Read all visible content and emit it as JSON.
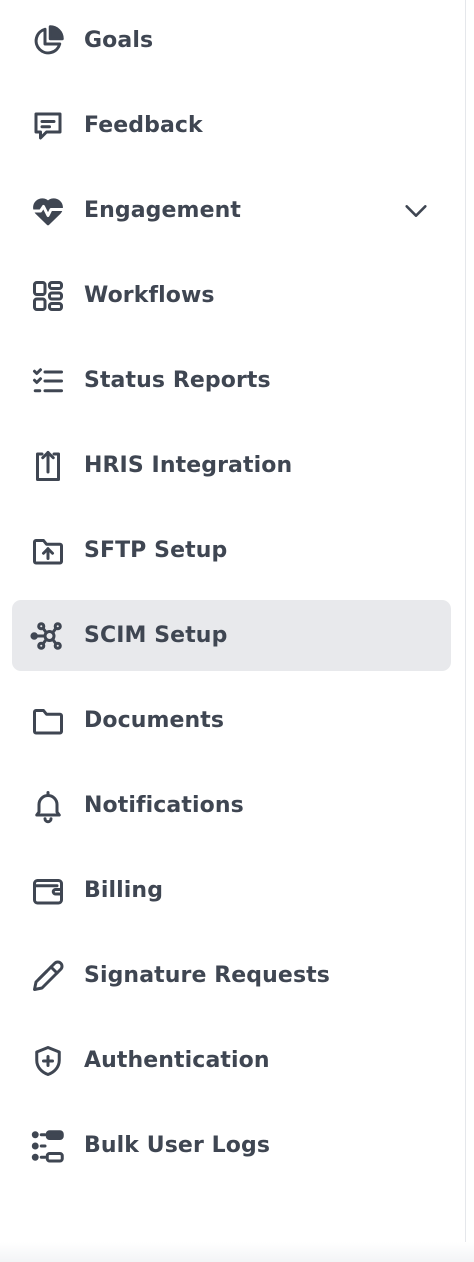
{
  "sidebar": {
    "items": [
      {
        "label": "Goals",
        "icon": "pie-chart-icon"
      },
      {
        "label": "Feedback",
        "icon": "message-square-icon"
      },
      {
        "label": "Engagement",
        "icon": "heart-pulse-icon",
        "expandable": true,
        "expand_icon": "chevron-down-icon"
      },
      {
        "label": "Workflows",
        "icon": "layout-icon"
      },
      {
        "label": "Status Reports",
        "icon": "checklist-icon"
      },
      {
        "label": "HRIS Integration",
        "icon": "upload-icon"
      },
      {
        "label": "SFTP Setup",
        "icon": "folder-upload-icon"
      },
      {
        "label": "SCIM Setup",
        "icon": "network-icon",
        "active": true
      },
      {
        "label": "Documents",
        "icon": "folder-icon"
      },
      {
        "label": "Notifications",
        "icon": "bell-icon"
      },
      {
        "label": "Billing",
        "icon": "wallet-icon"
      },
      {
        "label": "Signature Requests",
        "icon": "pen-icon"
      },
      {
        "label": "Authentication",
        "icon": "shield-plus-icon"
      },
      {
        "label": "Bulk User Logs",
        "icon": "list-toggle-icon"
      }
    ]
  },
  "colors": {
    "text": "#3f4652",
    "icon": "#3f4652",
    "active_bg": "#e8e9ec",
    "background": "#ffffff"
  }
}
